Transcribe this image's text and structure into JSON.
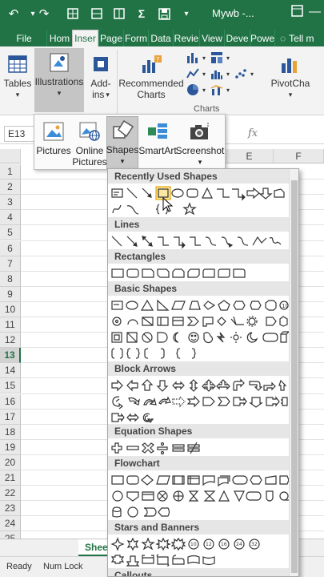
{
  "titlebar": {
    "title": "Mywb -...",
    "colors": {
      "excel_green": "#217346"
    }
  },
  "tabs": [
    {
      "label": "File"
    },
    {
      "label": "Hom"
    },
    {
      "label": "Inser"
    },
    {
      "label": "Page"
    },
    {
      "label": "Form"
    },
    {
      "label": "Data"
    },
    {
      "label": "Revie"
    },
    {
      "label": "View"
    },
    {
      "label": "Deve"
    },
    {
      "label": "Powe"
    },
    {
      "label": "Tell m"
    }
  ],
  "ribbon": {
    "tables": "Tables",
    "illustrations": "Illustrations",
    "addins_line1": "Add-",
    "addins_line2": "ins",
    "recommended_line1": "Recommended",
    "recommended_line2": "Charts",
    "pivotchart": "PivotCha",
    "charts_group": "Charts"
  },
  "formula": {
    "namebox": "E13",
    "fx": "fx"
  },
  "columns": [
    "E",
    "F"
  ],
  "rows": [
    "1",
    "2",
    "3",
    "4",
    "5",
    "6",
    "7",
    "8",
    "9",
    "10",
    "11",
    "12",
    "13",
    "14",
    "15",
    "16",
    "17",
    "18",
    "19",
    "20",
    "21",
    "22",
    "23",
    "24",
    "25"
  ],
  "active_row": "13",
  "sheet_tab": "Shee",
  "status": {
    "ready": "Ready",
    "numlock": "Num Lock"
  },
  "illustrations_menu": {
    "pictures": "Pictures",
    "online_line1": "Online",
    "online_line2": "Pictures",
    "shapes": "Shapes",
    "smartart": "SmartArt",
    "screenshot": "Screenshot"
  },
  "shapes_gallery": {
    "sections": [
      "Recently Used Shapes",
      "Lines",
      "Rectangles",
      "Basic Shapes",
      "Block Arrows",
      "Equation Shapes",
      "Flowchart",
      "Stars and Banners",
      "Callouts"
    ]
  }
}
